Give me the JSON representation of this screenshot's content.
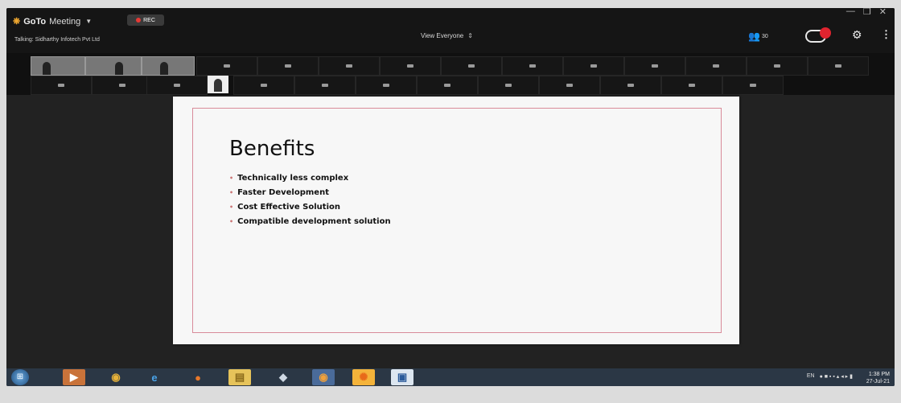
{
  "app": {
    "brand": "GoTo",
    "brand_suffix": "Meeting",
    "rec_label": "REC",
    "talking": "Talking: Sidharthy Infotech Pvt Ltd",
    "view_mode": "View Everyone",
    "attendee_count": "30"
  },
  "slide": {
    "title": "Benefits",
    "bullets": [
      "Technically less complex",
      "Faster Development",
      "Cost Effective Solution",
      "Compatible development solution"
    ]
  },
  "taskbar": {
    "language": "EN",
    "time": "1:38 PM",
    "date": "27-Jul-21"
  },
  "colors": {
    "record_red": "#e0242f",
    "slide_border": "#d98b9a",
    "taskbar": "#2b3745"
  },
  "icons": [
    "gotomeeting-logo-icon",
    "record-dot-icon",
    "attendees-icon",
    "record-toggle-icon",
    "gear-icon",
    "more-vertical-icon",
    "start-icon",
    "chrome-icon",
    "ie-icon",
    "firefox-icon",
    "folder-icon"
  ]
}
